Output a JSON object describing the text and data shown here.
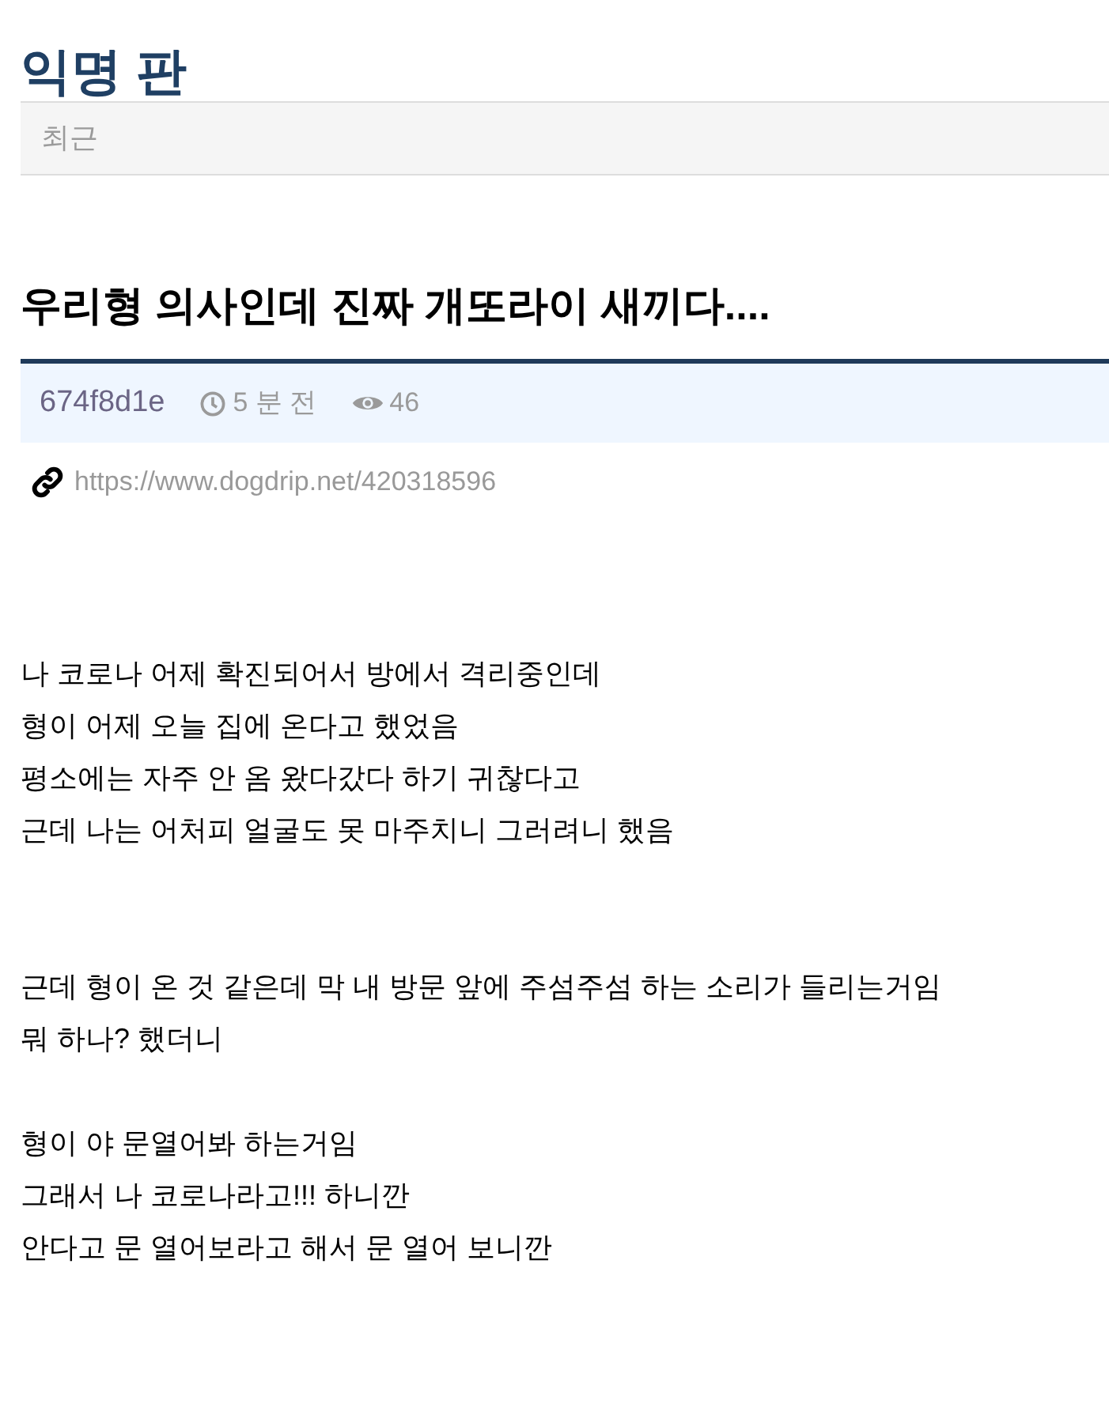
{
  "board": {
    "title": "익명 판"
  },
  "tabs": [
    {
      "label": "최근",
      "selected": false
    }
  ],
  "post": {
    "title": "우리형 의사인데 진짜 개또라이 새끼다....",
    "author": "674f8d1e",
    "time": "5 분 전",
    "views": "46",
    "link": "https://www.dogdrip.net/420318596",
    "paragraphs": [
      [
        "나 코로나 어제 확진되어서 방에서 격리중인데",
        "형이 어제 오늘 집에 온다고 했었음",
        "평소에는 자주 안 옴 왔다갔다 하기 귀찮다고",
        "근데 나는 어처피 얼굴도 못 마주치니 그러려니 했음"
      ],
      [
        "근데 형이 온 것 같은데 막 내 방문 앞에 주섬주섬 하는 소리가 들리는거임",
        "뭐 하나? 했더니"
      ],
      [
        "형이 야 문열어봐 하는거임",
        "그래서 나 코로나라고!!! 하니깐",
        "안다고 문 열어보라고 해서 문 열어 보니깐"
      ]
    ]
  }
}
